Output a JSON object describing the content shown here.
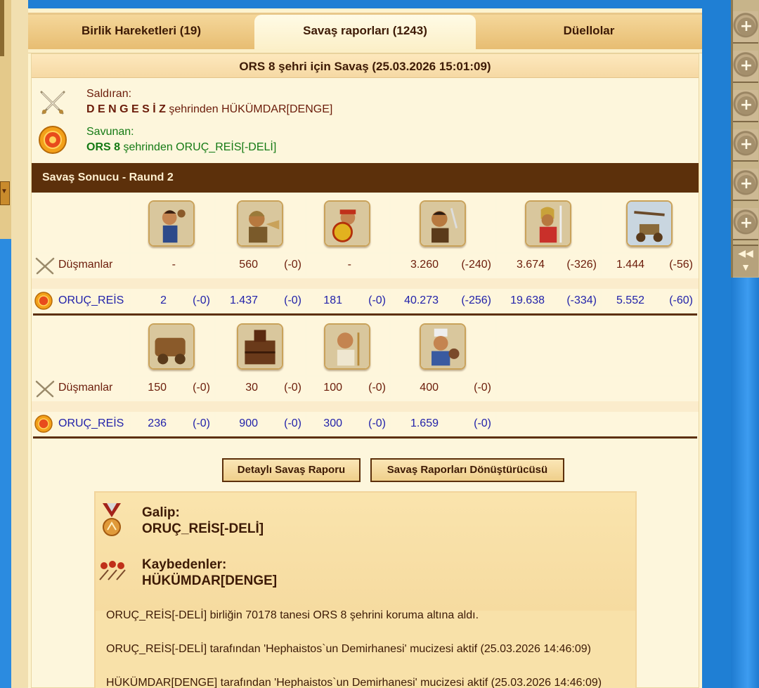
{
  "tabs": [
    {
      "label": "Birlik Hareketleri (19)"
    },
    {
      "label": "Savaş raporları (1243)"
    },
    {
      "label": "Düellolar"
    }
  ],
  "report": {
    "title": "ORS 8 şehri için Savaş (25.03.2026 15:01:09)",
    "attacker": {
      "label": "Saldıran:",
      "city": "D E N G E S İ Z",
      "rest": " şehrinden HÜKÜMDAR[DENGE]"
    },
    "defender": {
      "label": "Savunan:",
      "city": "ORS 8",
      "rest": " şehrinden ORUÇ_REİS[-DELİ]"
    },
    "result_title": "Savaş Sonucu - Raund 2"
  },
  "labels": {
    "enemies": "Düşmanlar",
    "own": "ORUÇ_REİS"
  },
  "row1": {
    "units": [
      "slinger-unit",
      "hoplite-unit",
      "swordsman-unit",
      "archer-unit",
      "horseman-unit",
      "catapult-unit"
    ],
    "enemy": [
      [
        "-",
        ""
      ],
      [
        "560",
        "(-0)"
      ],
      [
        "-",
        ""
      ],
      [
        "3.260",
        "(-240)"
      ],
      [
        "3.674",
        "(-326)"
      ],
      [
        "1.444",
        "(-56)"
      ]
    ],
    "own": [
      [
        "2",
        "(-0)"
      ],
      [
        "1.437",
        "(-0)"
      ],
      [
        "181",
        "(-0)"
      ],
      [
        "40.273",
        "(-256)"
      ],
      [
        "19.638",
        "(-334)"
      ],
      [
        "5.552",
        "(-60)"
      ]
    ]
  },
  "row2": {
    "units": [
      "chariot-unit",
      "siege-tower-unit",
      "priest-unit",
      "trader-unit"
    ],
    "enemy": [
      [
        "150",
        "(-0)"
      ],
      [
        "30",
        "(-0)"
      ],
      [
        "100",
        "(-0)"
      ],
      [
        "400",
        "(-0)"
      ]
    ],
    "own": [
      [
        "236",
        "(-0)"
      ],
      [
        "900",
        "(-0)"
      ],
      [
        "300",
        "(-0)"
      ],
      [
        "1.659",
        "(-0)"
      ]
    ]
  },
  "buttons": {
    "detail": "Detaylı Savaş Raporu",
    "converter": "Savaş Raporları Dönüştürücüsü"
  },
  "summary": {
    "winner_label": "Galip:",
    "winner": "ORUÇ_REİS[-DELİ]",
    "losers_label": "Kaybedenler:",
    "losers": "HÜKÜMDAR[DENGE]",
    "lines": [
      "ORUÇ_REİS[-DELİ] birliğin 70178 tanesi ORS 8 şehrini koruma altına aldı.",
      "ORUÇ_REİS[-DELİ] tarafından 'Hephaistos`un Demirhanesi' mucizesi aktif (25.03.2026 14:46:09)",
      "HÜKÜMDAR[DENGE] tarafından 'Hephaistos`un Demirhanesi' mucizesi aktif (25.03.2026 14:46:09)"
    ]
  },
  "rail": {
    "plus": "+",
    "arrow_left": "◀◀",
    "arrow_down": "▼"
  }
}
